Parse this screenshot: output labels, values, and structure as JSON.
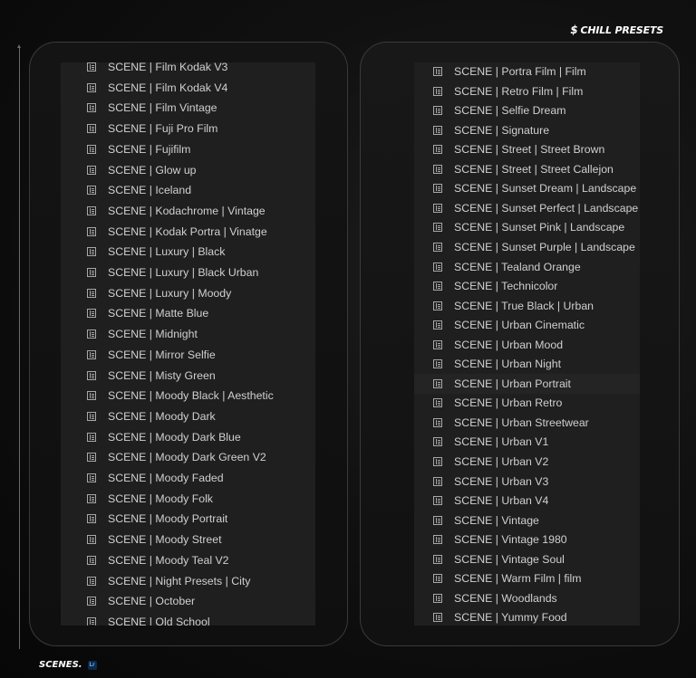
{
  "brand": {
    "icon": "lightning-s-icon",
    "icon_glyph": "$",
    "text": "CHILL PRESETS"
  },
  "footer": {
    "title": "SCENES.",
    "badge": "Lr",
    "badge_icon": "lightroom-icon"
  },
  "colors": {
    "background": "#0c0c0c",
    "list_bg": "#1f1f1f",
    "text": "#d0d0d0",
    "panel_border": "#3a3a3a"
  },
  "left_list": {
    "items": [
      "SCENE | Film Kodak V3",
      "SCENE | Film Kodak V4",
      "SCENE | Film Vintage",
      "SCENE | Fuji Pro Film",
      "SCENE | Fujifilm",
      "SCENE | Glow up",
      "SCENE | Iceland",
      "SCENE | Kodachrome | Vintage",
      "SCENE | Kodak Portra | Vinatge",
      "SCENE | Luxury | Black",
      "SCENE | Luxury | Black Urban",
      "SCENE | Luxury | Moody",
      "SCENE | Matte Blue",
      "SCENE | Midnight",
      "SCENE | Mirror Selfie",
      "SCENE | Misty Green",
      "SCENE | Moody Black | Aesthetic",
      "SCENE | Moody Dark",
      "SCENE | Moody Dark Blue",
      "SCENE | Moody Dark Green V2",
      "SCENE | Moody Faded",
      "SCENE | Moody Folk",
      "SCENE | Moody Portrait",
      "SCENE | Moody Street",
      "SCENE | Moody Teal V2",
      "SCENE | Night Presets | City",
      "SCENE | October",
      "SCENE | Old School"
    ]
  },
  "right_list": {
    "items": [
      "SCENE | Portra Film | Film",
      "SCENE | Retro Film | Film",
      "SCENE | Selfie Dream",
      "SCENE | Signature",
      "SCENE | Street | Street Brown",
      "SCENE | Street | Street Callejon",
      "SCENE | Sunset Dream | Landscape",
      "SCENE | Sunset Perfect | Landscape",
      "SCENE | Sunset Pink | Landscape",
      "SCENE | Sunset Purple | Landscape",
      "SCENE | Tealand Orange",
      "SCENE | Technicolor",
      "SCENE | True Black | Urban",
      "SCENE | Urban Cinematic",
      "SCENE | Urban Mood",
      "SCENE | Urban Night",
      "SCENE | Urban Portrait",
      "SCENE | Urban Retro",
      "SCENE | Urban Streetwear",
      "SCENE | Urban V1",
      "SCENE | Urban V2",
      "SCENE | Urban V3",
      "SCENE | Urban V4",
      "SCENE | Vintage",
      "SCENE | Vintage 1980",
      "SCENE | Vintage Soul",
      "SCENE | Warm Film | film",
      "SCENE | Woodlands",
      "SCENE | Yummy Food"
    ],
    "highlighted_index": 16
  }
}
